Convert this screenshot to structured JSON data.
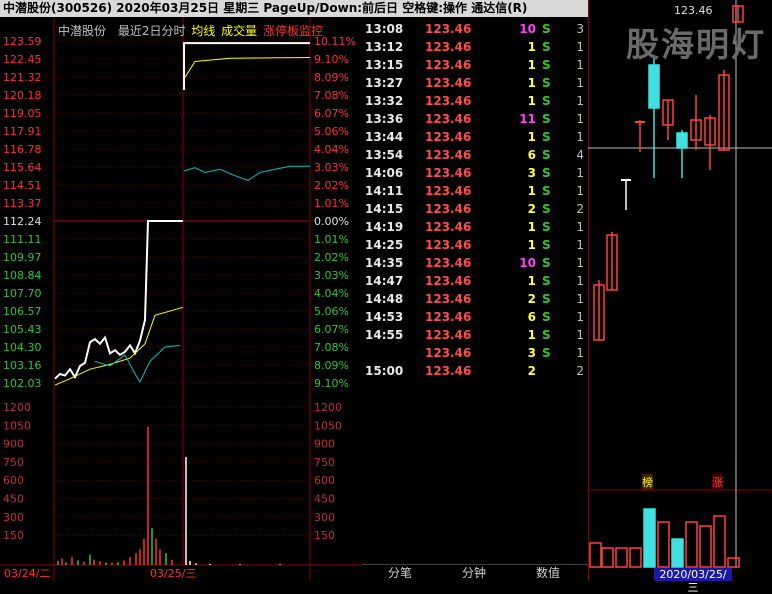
{
  "title_bar": {
    "text": "中潜股份(300526)  2020年03月25日 星期三  PageUp/Down:前后日  空格键:操作  通达信(R)"
  },
  "chart": {
    "legend": {
      "stock": "中潜股份",
      "period": "最近2日分时",
      "avg": "均线",
      "volume": "成交量",
      "limit": "涨停板监控"
    },
    "price_labels": [
      "123.59",
      "122.45",
      "121.32",
      "120.18",
      "119.05",
      "117.91",
      "116.78",
      "115.64",
      "114.51",
      "113.37",
      "112.24",
      "111.11",
      "109.97",
      "108.84",
      "107.70",
      "106.57",
      "105.43",
      "104.30",
      "103.16",
      "102.03"
    ],
    "pct_labels": [
      "10.11%",
      "9.10%",
      "8.09%",
      "7.08%",
      "6.07%",
      "5.06%",
      "4.04%",
      "3.03%",
      "2.02%",
      "1.01%",
      "0.00%",
      "1.01%",
      "2.02%",
      "3.03%",
      "4.04%",
      "5.06%",
      "6.07%",
      "7.08%",
      "8.09%",
      "9.10%"
    ],
    "vol_labels": [
      "1200",
      "1050",
      "900",
      "750",
      "600",
      "450",
      "300",
      "150"
    ],
    "date_labels": [
      "03/24/二",
      "03/25/三"
    ],
    "colors": {
      "up": "#ff3030",
      "down": "#00c0c0",
      "price": "#ffffff",
      "avg": "#ffff00",
      "grid": "#8b0000"
    }
  },
  "trades": [
    {
      "time": "13:08",
      "price": "123.46",
      "vol": "10",
      "side": "S",
      "count": "3",
      "vol_color": "#ff40ff"
    },
    {
      "time": "13:12",
      "price": "123.46",
      "vol": "1",
      "side": "S",
      "count": "1",
      "vol_color": "#ffff40"
    },
    {
      "time": "13:15",
      "price": "123.46",
      "vol": "1",
      "side": "S",
      "count": "1",
      "vol_color": "#ffff40"
    },
    {
      "time": "13:27",
      "price": "123.46",
      "vol": "1",
      "side": "S",
      "count": "1",
      "vol_color": "#ffff40"
    },
    {
      "time": "13:32",
      "price": "123.46",
      "vol": "1",
      "side": "S",
      "count": "1",
      "vol_color": "#ffff40"
    },
    {
      "time": "13:36",
      "price": "123.46",
      "vol": "11",
      "side": "S",
      "count": "1",
      "vol_color": "#ff40ff"
    },
    {
      "time": "13:44",
      "price": "123.46",
      "vol": "1",
      "side": "S",
      "count": "1",
      "vol_color": "#ffff40"
    },
    {
      "time": "13:54",
      "price": "123.46",
      "vol": "6",
      "side": "S",
      "count": "4",
      "vol_color": "#ffff40"
    },
    {
      "time": "14:06",
      "price": "123.46",
      "vol": "3",
      "side": "S",
      "count": "1",
      "vol_color": "#ffff40"
    },
    {
      "time": "14:11",
      "price": "123.46",
      "vol": "1",
      "side": "S",
      "count": "1",
      "vol_color": "#ffff40"
    },
    {
      "time": "14:15",
      "price": "123.46",
      "vol": "2",
      "side": "S",
      "count": "2",
      "vol_color": "#ffff40"
    },
    {
      "time": "14:19",
      "price": "123.46",
      "vol": "1",
      "side": "S",
      "count": "1",
      "vol_color": "#ffff40"
    },
    {
      "time": "14:25",
      "price": "123.46",
      "vol": "1",
      "side": "S",
      "count": "1",
      "vol_color": "#ffff40"
    },
    {
      "time": "14:35",
      "price": "123.46",
      "vol": "10",
      "side": "S",
      "count": "1",
      "vol_color": "#ff40ff"
    },
    {
      "time": "14:47",
      "price": "123.46",
      "vol": "1",
      "side": "S",
      "count": "1",
      "vol_color": "#ffff40"
    },
    {
      "time": "14:48",
      "price": "123.46",
      "vol": "2",
      "side": "S",
      "count": "1",
      "vol_color": "#ffff40"
    },
    {
      "time": "14:53",
      "price": "123.46",
      "vol": "6",
      "side": "S",
      "count": "1",
      "vol_color": "#ffff40"
    },
    {
      "time": "14:55",
      "price": "123.46",
      "vol": "1",
      "side": "S",
      "count": "1",
      "vol_color": "#ffff40"
    },
    {
      "time": "",
      "price": "123.46",
      "vol": "3",
      "side": "S",
      "count": "1",
      "vol_color": "#ffff40"
    },
    {
      "time": "15:00",
      "price": "123.46",
      "vol": "2",
      "side": "",
      "count": "2",
      "vol_color": "#ffff40"
    }
  ],
  "tabs": {
    "t1": "分笔",
    "t2": "分钟",
    "t3": "数值"
  },
  "kline": {
    "crosshair_price": "123.46",
    "date_label": "2020/03/25/三",
    "tag_rank": "榜",
    "tag_up": "涨",
    "watermark": "股海明灯"
  }
}
